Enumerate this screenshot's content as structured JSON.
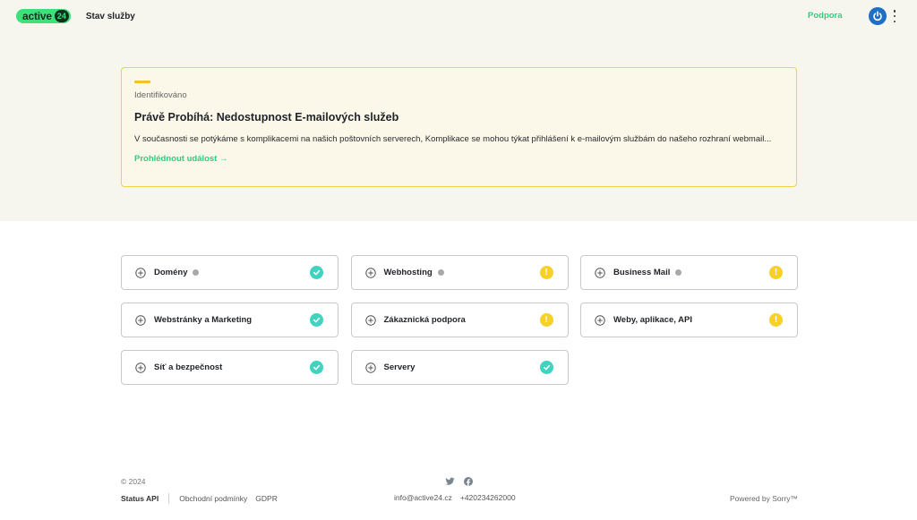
{
  "header": {
    "logo_text": "active",
    "logo_num": "24",
    "title": "Stav služby",
    "support_label": "Podpora"
  },
  "incident": {
    "status": "Identifikováno",
    "title": "Právě Probíhá: Nedostupnost E-mailových služeb",
    "text": "V současnosti se potýkáme s komplikacemi na našich poštovních serverech, Komplikace se mohou týkat přihlášení k e-mailovým službám do našeho rozhraní webmail...",
    "link": "Prohlédnout událost →"
  },
  "services": [
    {
      "name": "Domény",
      "status": "ok",
      "info": true
    },
    {
      "name": "Webhosting",
      "status": "warn",
      "info": true
    },
    {
      "name": "Business Mail",
      "status": "warn",
      "info": true
    },
    {
      "name": "Webstránky a Marketing",
      "status": "ok",
      "info": false
    },
    {
      "name": "Zákaznická podpora",
      "status": "warn",
      "info": false
    },
    {
      "name": "Weby, aplikace, API",
      "status": "warn",
      "info": false
    },
    {
      "name": "Síť a bezpečnost",
      "status": "ok",
      "info": false
    },
    {
      "name": "Servery",
      "status": "ok",
      "info": false
    }
  ],
  "footer": {
    "copyright": "© 2024",
    "status_api": "Status API",
    "terms": "Obchodní podmínky",
    "gdpr": "GDPR",
    "email": "info@active24.cz",
    "phone": "+420234262000",
    "powered": "Powered by Sorry™"
  },
  "colors": {
    "accent_green": "#2ad07f",
    "ok_teal": "#3fd3c0",
    "warn_yellow": "#f7d12a",
    "banner_border": "#f3d04a",
    "top_bg": "#f6f5ee"
  }
}
